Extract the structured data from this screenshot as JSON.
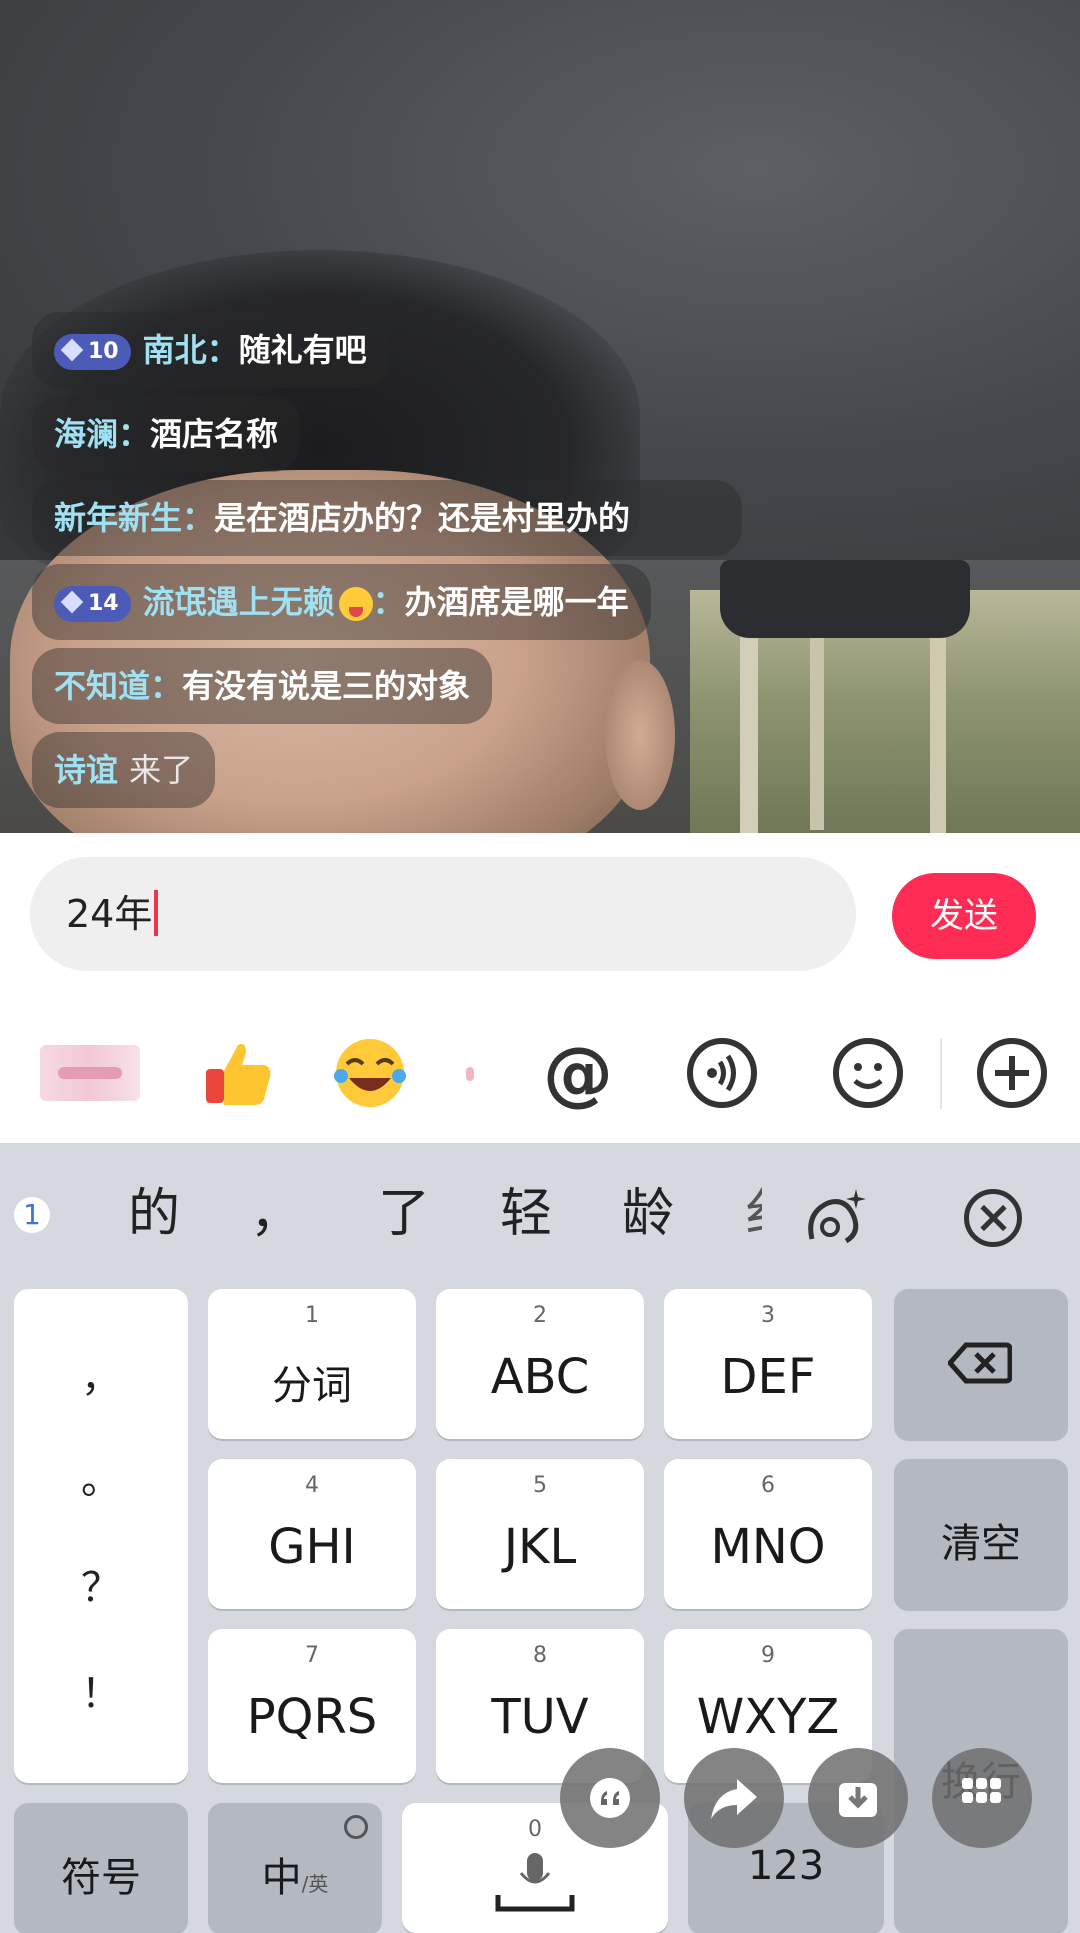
{
  "chat": {
    "messages": [
      {
        "badge": "10",
        "name": "南北：",
        "text": "随礼有吧"
      },
      {
        "badge": "",
        "name": "海澜：",
        "text": "酒店名称"
      },
      {
        "badge": "",
        "name": "新年新生：",
        "text": "是在酒店办的？还是村里办的"
      },
      {
        "badge": "14",
        "name": "流氓遇上无赖",
        "name_suffix": "：",
        "text": "办酒席是哪一年"
      },
      {
        "badge": "",
        "name": "不知道：",
        "text": "有没有说是三的对象"
      },
      {
        "badge": "",
        "name": "诗谊",
        "text": "来了"
      }
    ]
  },
  "input": {
    "value": "24年",
    "send_label": "发送"
  },
  "tools": {
    "icons": [
      "sticker-icon",
      "thumbs-up-icon",
      "laughing-emoji-icon",
      "at-icon",
      "voice-icon",
      "smiley-icon",
      "plus-icon"
    ],
    "at_label": "@"
  },
  "keyboard": {
    "candidate_arrow": "1",
    "candidates": [
      "的",
      "，",
      "了",
      "轻",
      "龄",
      "纟"
    ],
    "punctuation": [
      "，",
      "。",
      "？",
      "！"
    ],
    "keys": [
      {
        "num": "1",
        "label": "分词"
      },
      {
        "num": "2",
        "label": "ABC"
      },
      {
        "num": "3",
        "label": "DEF"
      },
      {
        "num": "4",
        "label": "GHI"
      },
      {
        "num": "5",
        "label": "JKL"
      },
      {
        "num": "6",
        "label": "MNO"
      },
      {
        "num": "7",
        "label": "PQRS"
      },
      {
        "num": "8",
        "label": "TUV"
      },
      {
        "num": "9",
        "label": "WXYZ"
      }
    ],
    "clear_label": "清空",
    "enter_label": "换行",
    "symbol_label": "符号",
    "lang_label": "中",
    "lang_sub": "/英",
    "space_num": "0",
    "num_label": "123"
  },
  "colors": {
    "send_button": "#fe2c55",
    "chat_name": "#9fe0f3",
    "keyboard_bg": "#d5d8de"
  }
}
